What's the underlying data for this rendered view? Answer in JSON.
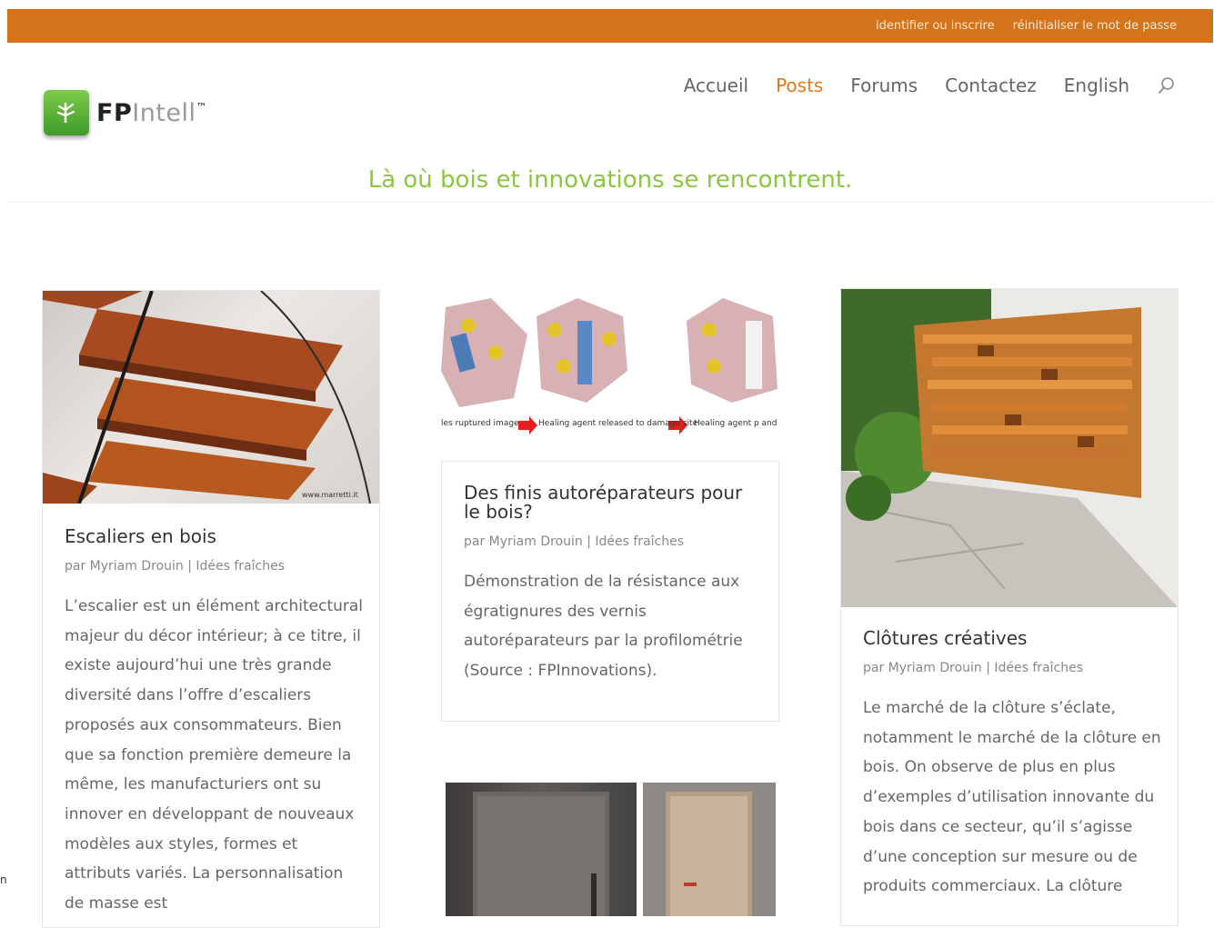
{
  "topbar": {
    "login_link": "identifier ou inscrire",
    "reset_link": "réinitialiser le mot de passe"
  },
  "logo": {
    "fp": "FP",
    "intell": "Intell",
    "tm": "™"
  },
  "nav": {
    "items": [
      "Accueil",
      "Posts",
      "Forums",
      "Contactez",
      "English"
    ],
    "active": "Posts",
    "search_icon": "search-icon"
  },
  "tagline": "Là où bois et innovations se rencontrent.",
  "posts": [
    {
      "title": "Escaliers en bois",
      "meta": "par Myriam Drouin | Idées fraîches",
      "excerpt": "L’escalier est un élément architectural majeur du décor intérieur; à ce titre, il existe aujourd’hui une très grande diversité dans l’offre d’escaliers proposés aux consommateurs. Bien que sa fonction première demeure la même, les manufacturiers ont su innover en développant de nouveaux modèles aux styles, formes et attributs variés. La personnalisation de masse est",
      "image_credit": "www.marretti.it"
    },
    {
      "title": "Des finis autoréparateurs pour le bois?",
      "meta": "par Myriam Drouin | Idées fraîches",
      "excerpt": "Démonstration de la résistance aux égratignures des vernis autoréparateurs par la profilométrie (Source : FPInnovations).",
      "image_labels": [
        "les ruptured image",
        "Healing agent released to damage site",
        "Healing agent p and heals d"
      ]
    },
    {
      "title": "Clôtures créatives",
      "meta": "par Myriam Drouin | Idées fraîches",
      "excerpt": "Le marché de la clôture s’éclate, notamment le marché de la clôture en bois. On observe de plus en plus d’exemples d’utilisation innovante du bois dans ce secteur, qu’il s’agisse d’une conception sur mesure ou de produits commerciaux. La clôture"
    }
  ],
  "side_fragment": "n",
  "colors": {
    "accent": "#d4731a",
    "tagline": "#8cc63f",
    "active_nav": "#e0781f"
  }
}
